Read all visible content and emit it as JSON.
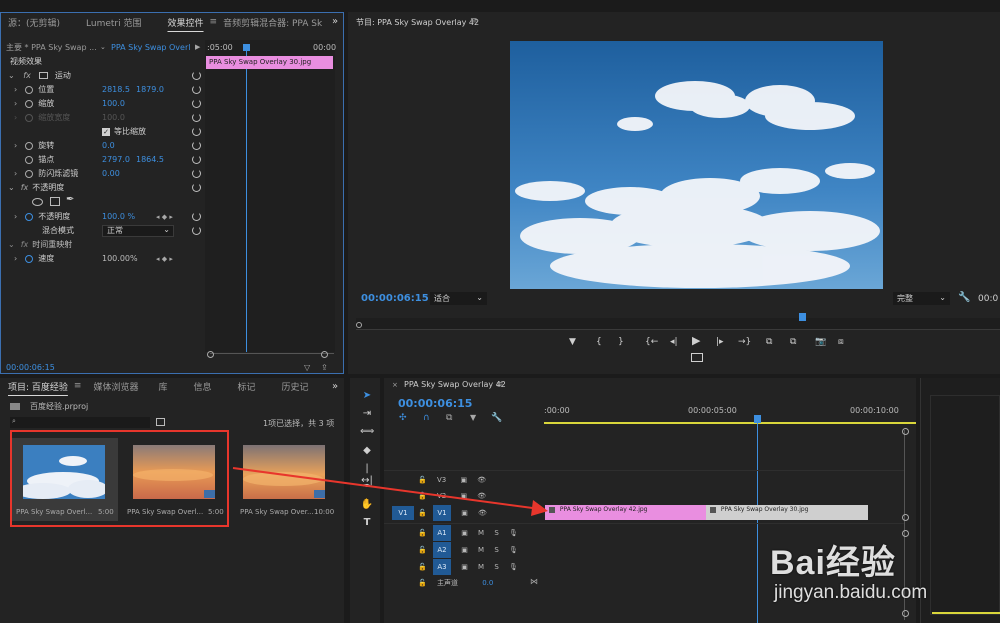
{
  "source_panel": {
    "tabs": [
      "源：(无剪辑)",
      "Lumetri 范围",
      "效果控件",
      "音频剪辑混合器: PPA Sk"
    ],
    "active_tab": "效果控件"
  },
  "effect_controls": {
    "master_label": "主要 * PPA Sky Swap ...",
    "clip_dropdown": "PPA Sky Swap Overl...",
    "mini_timeline_start": ":05:00",
    "mini_timeline_end": "00:00",
    "mini_clip_label": "PPA Sky Swap Overlay 30.jpg",
    "section_video": "视频效果",
    "motion": "运动",
    "position_label": "位置",
    "position_x": "2818.5",
    "position_y": "1879.0",
    "scale_label": "缩放",
    "scale_value": "100.0",
    "scale_width_label": "缩放宽度",
    "scale_width_value": "100.0",
    "uniform_label": "等比缩放",
    "rotation_label": "旋转",
    "rotation_value": "0.0",
    "anchor_label": "锚点",
    "anchor_x": "2797.0",
    "anchor_y": "1864.5",
    "flicker_label": "防闪烁滤镜",
    "flicker_value": "0.00",
    "opacity_section": "不透明度",
    "opacity_label": "不透明度",
    "opacity_value": "100.0 %",
    "blend_label": "混合模式",
    "blend_value": "正常",
    "time_remap": "时间重映射",
    "speed_label": "速度",
    "speed_value": "100.00%",
    "timecode": "00:00:06:15"
  },
  "program": {
    "title": "节目: PPA Sky Swap Overlay 42",
    "timecode": "00:00:06:15",
    "fit": "适合",
    "quality": "完整",
    "right_timecode": "00:0"
  },
  "project": {
    "tabs": [
      "项目: 百度经验",
      "媒体浏览器",
      "库",
      "信息",
      "标记",
      "历史记"
    ],
    "active_tab": "项目: 百度经验",
    "file": "百度经验.prproj",
    "selection_info": "1项已选择，共 3 项",
    "items": [
      {
        "name": "PPA Sky Swap Overl...",
        "duration": "5:00"
      },
      {
        "name": "PPA Sky Swap Overl...",
        "duration": "5:00"
      },
      {
        "name": "PPA Sky Swap Over...",
        "duration": "10:00"
      }
    ]
  },
  "timeline": {
    "tab": "PPA Sky Swap Overlay 42",
    "timecode": "00:00:06:15",
    "ruler": [
      ":00:00",
      "00:00:05:00",
      "00:00:10:00"
    ],
    "tracks": [
      "V3",
      "V2",
      "V1",
      "A1",
      "A2",
      "A3"
    ],
    "source_v": "V1",
    "master_label": "主声道",
    "master_value": "0.0",
    "clips": [
      "PPA Sky Swap Overlay 42.jpg",
      "PPA Sky Swap Overlay 30.jpg"
    ]
  },
  "watermark": {
    "brand": "Bai经验",
    "url": "jingyan.baidu.com"
  },
  "colors": {
    "accent": "#3d8fe0",
    "clip_pink": "#e98ee0",
    "clip_gray": "#cfcfcf",
    "annotation": "#e8362c"
  }
}
